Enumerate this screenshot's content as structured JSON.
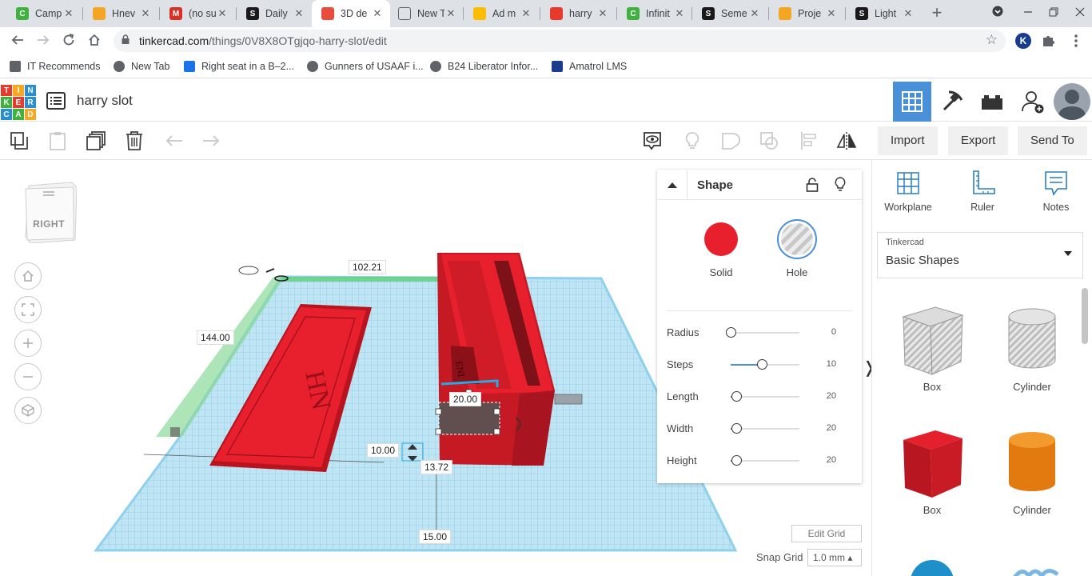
{
  "browser": {
    "tabs": [
      {
        "title": "Camp",
        "fav_color": "#3fb13f",
        "fav_glyph": "C",
        "active": false
      },
      {
        "title": "Hnev",
        "fav_color": "#f4a622",
        "fav_glyph": "",
        "active": false
      },
      {
        "title": "(no su",
        "fav_color": "#d93025",
        "fav_glyph": "M",
        "active": false
      },
      {
        "title": "Daily",
        "fav_color": "#1a1a1a",
        "fav_glyph": "S",
        "active": false
      },
      {
        "title": "3D de",
        "fav_color": "#e84c3d",
        "fav_glyph": "",
        "active": true
      },
      {
        "title": "New Tab",
        "fav_color": "",
        "fav_glyph": "",
        "active": false
      },
      {
        "title": "Ad m",
        "fav_color": "#fbbc04",
        "fav_glyph": "",
        "active": false
      },
      {
        "title": "harry",
        "fav_color": "#e8392d",
        "fav_glyph": "",
        "active": false
      },
      {
        "title": "Infinit",
        "fav_color": "#3fb13f",
        "fav_glyph": "C",
        "active": false
      },
      {
        "title": "Seme",
        "fav_color": "#1a1a1a",
        "fav_glyph": "S",
        "active": false
      },
      {
        "title": "Proje",
        "fav_color": "#f4a622",
        "fav_glyph": "",
        "active": false
      },
      {
        "title": "Light",
        "fav_color": "#1a1a1a",
        "fav_glyph": "S",
        "active": false
      }
    ],
    "close_glyph": "✕",
    "new_tab_glyph": "+",
    "url_host": "tinkercad.com",
    "url_path": "/things/0V8X8OTgjqo-harry-slot/edit",
    "bookmarks": [
      {
        "label": "IT Recommends",
        "icon": "folder-icon"
      },
      {
        "label": "New Tab",
        "icon": "globe-icon"
      },
      {
        "label": "Right seat in a B–2...",
        "icon": "plane-icon"
      },
      {
        "label": "Gunners of USAAF i...",
        "icon": "globe-icon"
      },
      {
        "label": "B24 Liberator Infor...",
        "icon": "globe-icon"
      },
      {
        "label": "Amatrol LMS",
        "icon": "amatrol-icon"
      }
    ]
  },
  "app": {
    "logo_letters": [
      "T",
      "I",
      "N",
      "K",
      "E",
      "R",
      "C",
      "A",
      "D"
    ],
    "design_title": "harry slot",
    "import_label": "Import",
    "export_label": "Export",
    "send_to_label": "Send To"
  },
  "workspace": {
    "view_cube_label": "RIGHT",
    "dimensions": {
      "top_length": "102.21",
      "side_length": "144.00",
      "length": "20.00",
      "elevation": "10.00",
      "offset_a": "13.72",
      "offset_b": "15.00"
    },
    "edit_grid_label": "Edit Grid",
    "snap_grid_label": "Snap Grid",
    "snap_grid_value": "1.0 mm ▴"
  },
  "shape_panel": {
    "title": "Shape",
    "solid_label": "Solid",
    "hole_label": "Hole",
    "solid_color": "#e8202e",
    "props": [
      {
        "name": "Radius",
        "value": "0",
        "level": 0.0
      },
      {
        "name": "Steps",
        "value": "10",
        "level": 0.45
      },
      {
        "name": "Length",
        "value": "20",
        "level": 0.08
      },
      {
        "name": "Width",
        "value": "20",
        "level": 0.08
      },
      {
        "name": "Height",
        "value": "20",
        "level": 0.08
      }
    ]
  },
  "right_panel": {
    "tools": [
      {
        "label": "Workplane",
        "icon": "workplane-icon"
      },
      {
        "label": "Ruler",
        "icon": "ruler-icon"
      },
      {
        "label": "Notes",
        "icon": "notes-icon"
      }
    ],
    "library_source": "Tinkercad",
    "library_name": "Basic Shapes",
    "shapes": [
      {
        "label": "Box",
        "style": "hole"
      },
      {
        "label": "Cylinder",
        "style": "hole"
      },
      {
        "label": "Box",
        "style": "red"
      },
      {
        "label": "Cylinder",
        "style": "orange"
      }
    ]
  },
  "colors": {
    "accent_blue": "#4a90d9",
    "tinker_red": "#e8202e",
    "grid_blue": "#a6d9ef"
  }
}
